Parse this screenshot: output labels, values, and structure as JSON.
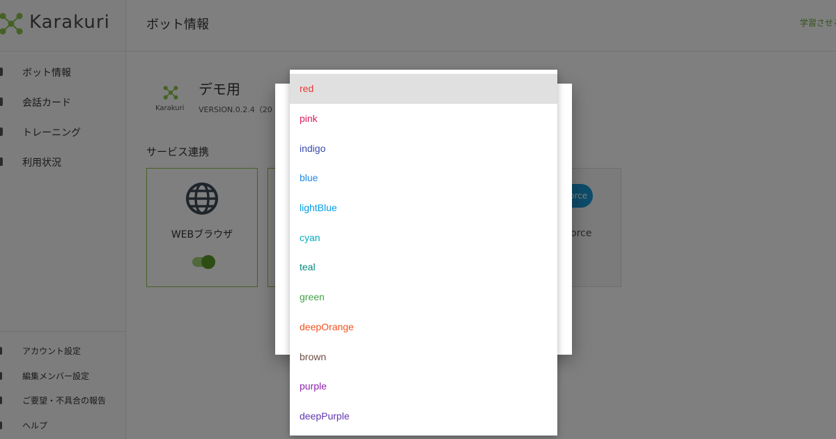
{
  "app": {
    "logo_text": "Karakuri",
    "page_title": "ボット情報",
    "learn_link": "学習させる"
  },
  "sidebar": {
    "items": [
      {
        "label": "ボット情報"
      },
      {
        "label": "会話カード"
      },
      {
        "label": "トレーニング"
      },
      {
        "label": "利用状況"
      }
    ],
    "bottom_items": [
      {
        "label": "アカウント設定"
      },
      {
        "label": "編集メンバー設定"
      },
      {
        "label": "ご要望・不具合の報告"
      },
      {
        "label": "ヘルプ"
      }
    ]
  },
  "bot": {
    "logo_text": "Karakuri",
    "name": "デモ用",
    "version": "VERSION.0.2.4（20"
  },
  "services": {
    "title": "サービス連携",
    "web_label": "WEBブラウザ",
    "web_enabled": true,
    "sf_cloud_text": "orce",
    "sf_label": "orce"
  },
  "dropdown": {
    "selected": "red",
    "options": [
      {
        "label": "red",
        "color": "#e53935"
      },
      {
        "label": "pink",
        "color": "#d81b60"
      },
      {
        "label": "indigo",
        "color": "#3949ab"
      },
      {
        "label": "blue",
        "color": "#1e88e5"
      },
      {
        "label": "lightBlue",
        "color": "#039be5"
      },
      {
        "label": "cyan",
        "color": "#00acc1"
      },
      {
        "label": "teal",
        "color": "#00897b"
      },
      {
        "label": "green",
        "color": "#43a047"
      },
      {
        "label": "deepOrange",
        "color": "#f4511e"
      },
      {
        "label": "brown",
        "color": "#6d4c41"
      },
      {
        "label": "purple",
        "color": "#8e24aa"
      },
      {
        "label": "deepPurple",
        "color": "#5e35b1"
      }
    ]
  },
  "colors": {
    "accent": "#8bc34a",
    "accent_dark": "#5a9b28"
  }
}
